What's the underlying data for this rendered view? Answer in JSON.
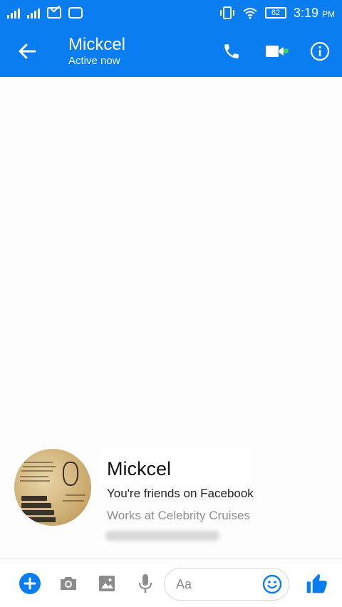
{
  "status_bar": {
    "battery": "62",
    "time": "3:19",
    "ampm": "PM"
  },
  "header": {
    "contact_name": "Mickcel",
    "contact_status": "Active now",
    "icons": [
      "back-arrow-icon",
      "phone-icon",
      "video-camera-icon",
      "info-icon"
    ],
    "active_dot_color": "#42d35c"
  },
  "profile": {
    "name": "Mickcel",
    "friends_text": "You're friends on Facebook",
    "work_text": "Works at Celebrity Cruises"
  },
  "composer": {
    "placeholder": "Aa",
    "icons": [
      "plus-icon",
      "camera-icon",
      "gallery-icon",
      "microphone-icon",
      "emoji-icon",
      "thumbs-up-icon"
    ]
  },
  "colors": {
    "brand": "#0a7df0",
    "background": "#fdfdfd",
    "secondary_text": "#8e8e8e"
  }
}
